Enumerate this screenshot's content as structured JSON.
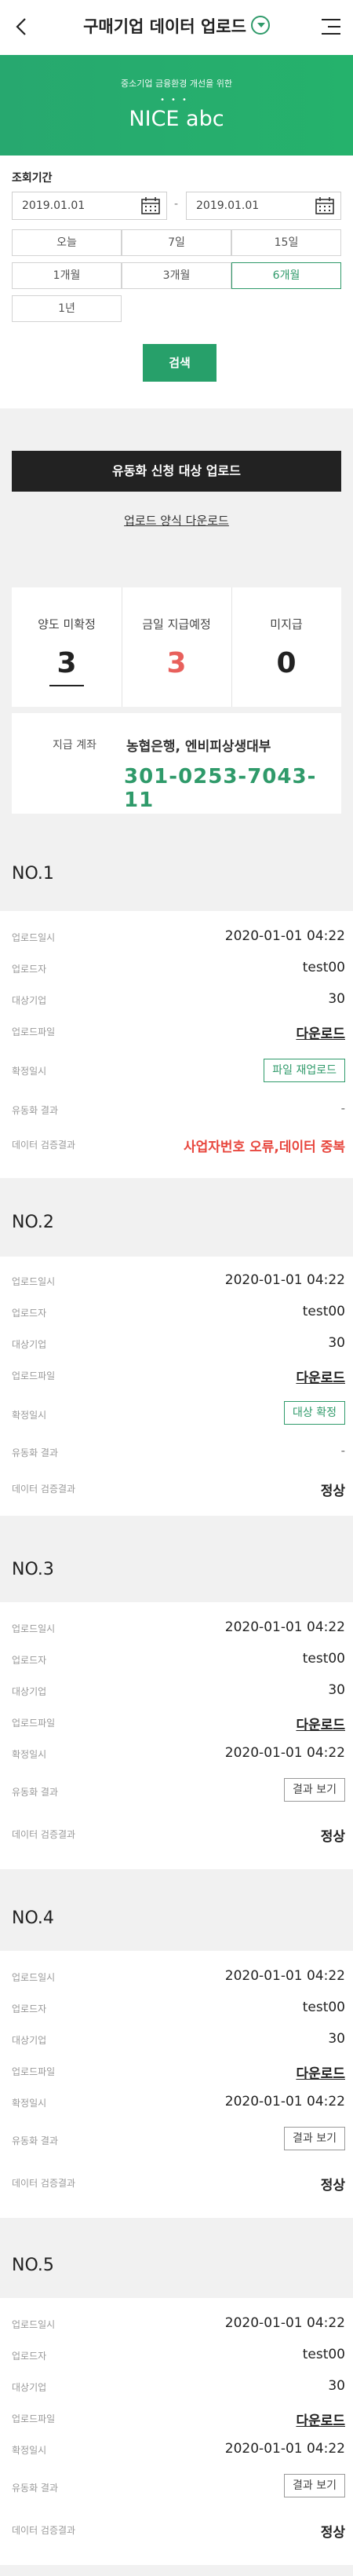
{
  "header": {
    "title": "구매기업 데이터 업로드"
  },
  "banner": {
    "subtitle": "중소기업 금융환경 개선을 위한",
    "brand": "NICE abc"
  },
  "search": {
    "label": "조회기간",
    "start_date": "2019.01.01",
    "end_date": "2019.01.01",
    "dash": "-",
    "periods": [
      "오늘",
      "7일",
      "15일",
      "1개월",
      "3개월",
      "6개월",
      "1년"
    ],
    "active_period": "6개월",
    "button": "검색"
  },
  "upload": {
    "title": "유동화 신청 대상 업로드",
    "form_link": "업로드 양식 다운로드"
  },
  "stats": [
    {
      "label": "양도 미확정",
      "value": "3"
    },
    {
      "label": "금일 지급예정",
      "value": "3"
    },
    {
      "label": "미지급",
      "value": "0"
    }
  ],
  "account": {
    "label": "지급 계좌",
    "bank": "농협은행, 엔비피상생대부",
    "number": "301-0253-7043-11"
  },
  "field_labels": {
    "upload_time": "업로드일시",
    "uploader": "업로드자",
    "target": "대상기업",
    "file": "업로드파일",
    "confirm": "확정일시",
    "liquidation": "유동화 결과",
    "verify": "데이터 검증결과"
  },
  "records": [
    {
      "title": "NO.1",
      "upload_time": "2020-01-01 04:22",
      "uploader": "test00",
      "target": "30",
      "file": "다운로드",
      "confirm_button": "파일 재업로드",
      "liquidation": "-",
      "verify": "사업자번호 오류,데이터 중복"
    },
    {
      "title": "NO.2",
      "upload_time": "2020-01-01 04:22",
      "uploader": "test00",
      "target": "30",
      "file": "다운로드",
      "confirm_button": "대상 확정",
      "liquidation": "-",
      "verify": "정상"
    },
    {
      "title": "NO.3",
      "upload_time": "2020-01-01 04:22",
      "uploader": "test00",
      "target": "30",
      "file": "다운로드",
      "confirm": "2020-01-01 04:22",
      "liquidation_button": "결과 보기",
      "verify": "정상"
    },
    {
      "title": "NO.4",
      "upload_time": "2020-01-01 04:22",
      "uploader": "test00",
      "target": "30",
      "file": "다운로드",
      "confirm": "2020-01-01 04:22",
      "liquidation_button": "결과 보기",
      "verify": "정상"
    },
    {
      "title": "NO.5",
      "upload_time": "2020-01-01 04:22",
      "uploader": "test00",
      "target": "30",
      "file": "다운로드",
      "confirm": "2020-01-01 04:22",
      "liquidation_button": "결과 보기",
      "verify": "정상"
    }
  ]
}
